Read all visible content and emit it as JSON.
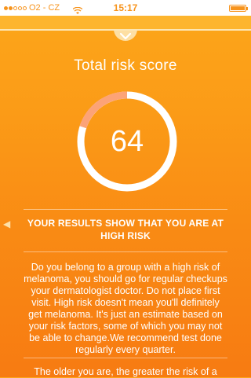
{
  "status_bar": {
    "carrier": "O2 - CZ",
    "time": "15:17",
    "signal_bars": 5,
    "signal_filled": 2,
    "icons": [
      "wifi-icon",
      "battery-icon"
    ]
  },
  "header": {
    "toggle_icon": "chevron-down-icon"
  },
  "score_section": {
    "title": "Total risk score",
    "score": "64",
    "gauge_fraction": 0.2,
    "gauge_track_color": "#ffffff",
    "gauge_arc_color": "#fca377"
  },
  "result": {
    "heading": "YOUR RESULTS SHOW THAT YOU ARE AT HIGH RISK",
    "side_icon": "chevron-left-icon",
    "paragraph": "Do you belong to a group with a high risk of melanoma, you should go for regular checkups your dermatologist doctor. Do not place first visit. High risk doesn't mean you'll definitely get melanoma. It's just an estimate based on your risk factors, some of which you may not be able to change.We recommend test done regularly every quarter.",
    "paragraph_2": "The older you are, the greater the risk of a"
  },
  "colors": {
    "background_top": "#fda71a",
    "background_bottom": "#f77b12",
    "status_accent": "#f7941d"
  }
}
